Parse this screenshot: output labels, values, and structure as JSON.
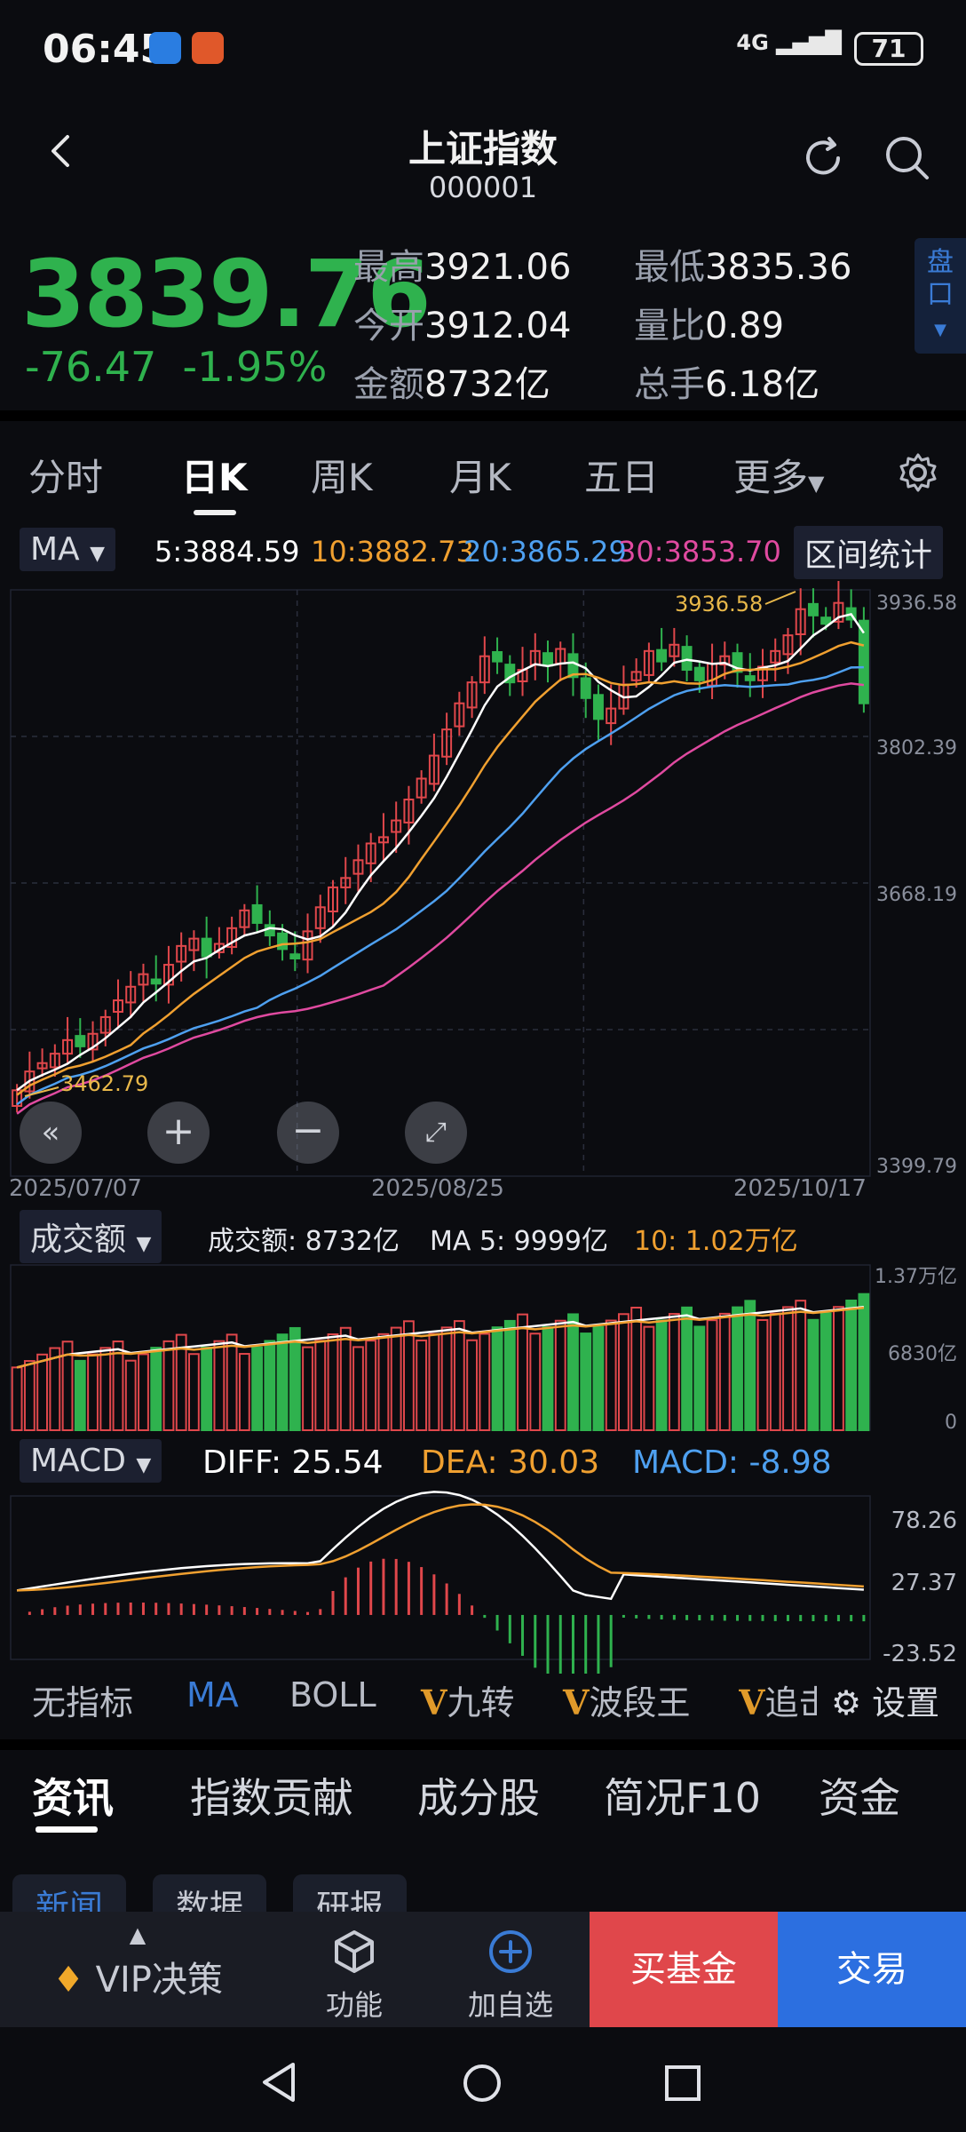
{
  "status": {
    "time": "06:45",
    "network": "4G",
    "battery": "71"
  },
  "header": {
    "title": "上证指数",
    "code": "000001",
    "icons": [
      "back-arrow-icon",
      "refresh-icon",
      "search-icon"
    ]
  },
  "quote": {
    "price": "3839.76",
    "change": "-76.47",
    "change_pct": "-1.95%",
    "high_label": "最高",
    "high": "3921.06",
    "low_label": "最低",
    "low": "3835.36",
    "open_label": "今开",
    "open": "3912.04",
    "ratio_label": "量比",
    "ratio": "0.89",
    "amount_label": "金额",
    "amount": "8732亿",
    "hand_label": "总手",
    "hand": "6.18亿",
    "pankou": "盘口"
  },
  "tabs": [
    "分时",
    "日K",
    "周K",
    "月K",
    "五日",
    "更多",
    "settings"
  ],
  "ma": {
    "selector": "MA",
    "ma5": "5:3884.59",
    "ma10": "10:3882.73",
    "ma20": "20:3865.29",
    "ma30": "30:3853.70",
    "stats_button": "区间统计"
  },
  "colors": {
    "up": "#e0474b",
    "down": "#2fb24e",
    "ma5": "#ffffff",
    "ma10": "#f0a030",
    "ma20": "#4ea0f0",
    "ma30": "#e04aa0"
  },
  "kline_labels": {
    "y_ticks": [
      "3936.58",
      "3802.39",
      "3668.19",
      "3399.79"
    ],
    "x_ticks": [
      "2025/07/07",
      "2025/08/25",
      "2025/10/17"
    ],
    "max_label": "3936.58",
    "min_label": "3462.79"
  },
  "volume": {
    "selector": "成交额",
    "amount": "成交额: 8732亿",
    "ma5": "MA 5: 9999亿",
    "ma10": "10: 1.02万亿",
    "y_ticks": [
      "1.37万亿",
      "6830亿",
      "0"
    ]
  },
  "macd": {
    "selector": "MACD",
    "diff": "DIFF: 25.54",
    "dea": "DEA: 30.03",
    "macd": "MACD: -8.98",
    "y_ticks": [
      "78.26",
      "27.37",
      "-23.52"
    ]
  },
  "indicators": [
    "无指标",
    "MA",
    "BOLL",
    "九转",
    "波段王",
    "追击",
    "设置"
  ],
  "indicator_prefix": "V",
  "subtabs": [
    "资讯",
    "指数贡献",
    "成分股",
    "简况F10",
    "资金"
  ],
  "chips": [
    "新闻",
    "数据",
    "研报"
  ],
  "bottom": {
    "vip": "VIP决策",
    "func": "功能",
    "add": "加自选",
    "buy_fund": "买基金",
    "trade": "交易"
  },
  "chart_data": {
    "type": "candlestick",
    "closes": [
      3470,
      3488,
      3496,
      3505,
      3518,
      3512,
      3524,
      3540,
      3556,
      3569,
      3581,
      3572,
      3590,
      3608,
      3615,
      3598,
      3610,
      3625,
      3642,
      3630,
      3618,
      3605,
      3596,
      3622,
      3645,
      3664,
      3673,
      3690,
      3706,
      3712,
      3728,
      3748,
      3768,
      3790,
      3815,
      3840,
      3860,
      3885,
      3880,
      3860,
      3872,
      3890,
      3876,
      3892,
      3865,
      3845,
      3825,
      3835,
      3858,
      3870,
      3890,
      3880,
      3896,
      3872,
      3862,
      3878,
      3885,
      3870,
      3862,
      3875,
      3890,
      3905,
      3930,
      3924,
      3916,
      3936,
      3920,
      3840
    ],
    "volume_range": [
      "0",
      "1.37万亿"
    ],
    "macd_range": [
      -23.52,
      78.26
    ]
  }
}
